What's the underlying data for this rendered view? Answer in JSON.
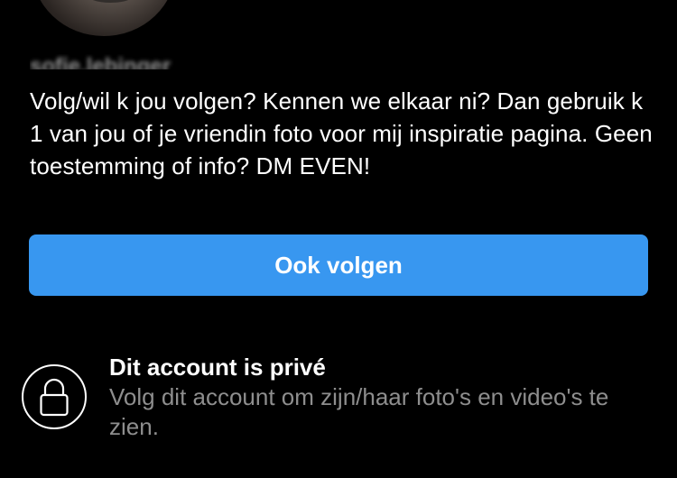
{
  "profile": {
    "username": "sofie.lebinger",
    "bio": "Volg/wil k jou volgen? Kennen we elkaar ni? Dan gebruik k 1 van jou of je vriendin foto voor mij inspiratie pagina. Geen toestemming of info? DM EVEN!"
  },
  "actions": {
    "follow_back_label": "Ook volgen"
  },
  "private_notice": {
    "title": "Dit account is privé",
    "description": "Volg dit account om zijn/haar foto's en video's te zien.",
    "icon": "lock-icon"
  },
  "colors": {
    "background": "#000000",
    "button": "#3897f0",
    "secondary_text": "#8e8e8e"
  }
}
